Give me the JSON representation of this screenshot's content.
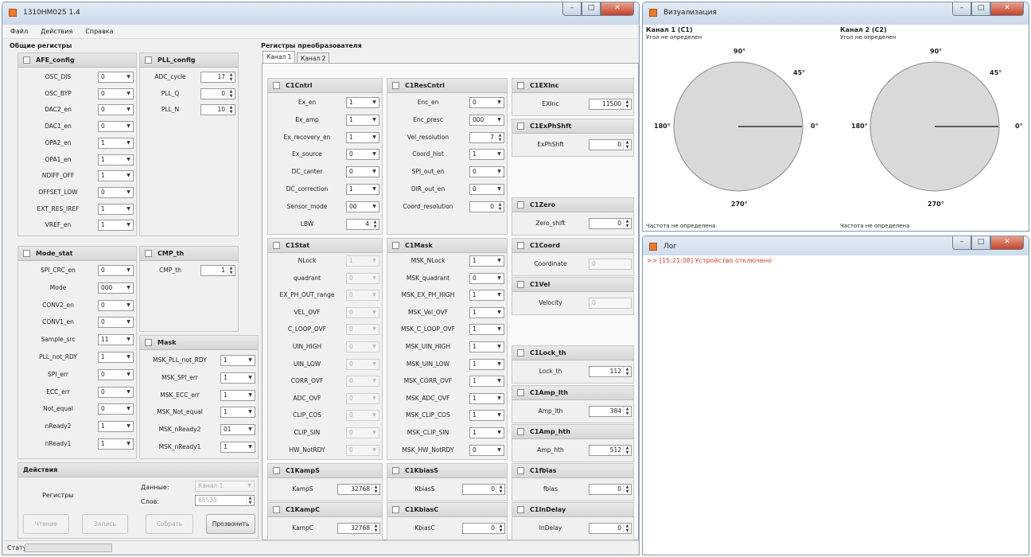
{
  "main_window": {
    "title": "1310HM025 1.4",
    "menu": [
      "Файл",
      "Действия",
      "Справка"
    ]
  },
  "general": {
    "heading": "Общие регистры",
    "afe": {
      "title": "AFE_config",
      "rows": [
        {
          "label": "OSC_DIS",
          "value": "0"
        },
        {
          "label": "OSC_BYP",
          "value": "0"
        },
        {
          "label": "DAC2_en",
          "value": "0"
        },
        {
          "label": "DAC1_en",
          "value": "0"
        },
        {
          "label": "OPA2_en",
          "value": "1"
        },
        {
          "label": "OPA1_en",
          "value": "1"
        },
        {
          "label": "NDIFF_OFF",
          "value": "1"
        },
        {
          "label": "OFFSET_LOW",
          "value": "0"
        },
        {
          "label": "EXT_RES_IREF",
          "value": "1"
        },
        {
          "label": "VREF_en",
          "value": "1"
        }
      ]
    },
    "pll": {
      "title": "PLL_config",
      "rows": [
        {
          "label": "ADC_cycle",
          "value": "17"
        },
        {
          "label": "PLL_Q",
          "value": "0"
        },
        {
          "label": "PLL_N",
          "value": "10"
        }
      ]
    },
    "mode_stat": {
      "title": "Mode_stat",
      "rows": [
        {
          "label": "SPI_CRC_en",
          "value": "0"
        },
        {
          "label": "Mode",
          "value": "000"
        },
        {
          "label": "CONV2_en",
          "value": "0"
        },
        {
          "label": "CONV1_en",
          "value": "0"
        },
        {
          "label": "Sample_src",
          "value": "11"
        },
        {
          "label": "PLL_not_RDY",
          "value": "1"
        },
        {
          "label": "SPI_err",
          "value": "0"
        },
        {
          "label": "ECC_err",
          "value": "0"
        },
        {
          "label": "Not_equal",
          "value": "0"
        },
        {
          "label": "nReady2",
          "value": "1"
        },
        {
          "label": "nReady1",
          "value": "1"
        }
      ]
    },
    "cmp": {
      "title": "CMP_th",
      "rows": [
        {
          "label": "CMP_th",
          "value": "1"
        }
      ]
    },
    "mask": {
      "title": "Mask",
      "rows": [
        {
          "label": "MSK_PLL_not_RDY",
          "value": "1"
        },
        {
          "label": "MSK_SPI_err",
          "value": "1"
        },
        {
          "label": "MSK_ECC_err",
          "value": "1"
        },
        {
          "label": "MSK_Not_equal",
          "value": "1"
        },
        {
          "label": "MSK_nReady2",
          "value": "01"
        },
        {
          "label": "MSK_nReady1",
          "value": "1"
        }
      ]
    }
  },
  "actions": {
    "title": "Действия",
    "registers_label": "Регистры",
    "data_label": "Данные:",
    "data_value": "Канал 1",
    "word_label": "Слов:",
    "word_value": "65535",
    "buttons": [
      "Чтение",
      "Запись",
      "Собрать",
      "Прозвонить"
    ]
  },
  "status": {
    "label": "Статус:",
    "progress": 0
  },
  "conv": {
    "heading": "Регистры преобразователя",
    "tabs": [
      "Канал 1",
      "Канал 2"
    ],
    "c1cntrl": {
      "title": "C1Cntrl",
      "rows": [
        {
          "label": "Ex_en",
          "value": "1",
          "kind": "dd"
        },
        {
          "label": "Ex_amp",
          "value": "1",
          "kind": "dd"
        },
        {
          "label": "Ex_recovery_en",
          "value": "1",
          "kind": "dd"
        },
        {
          "label": "Ex_source",
          "value": "0",
          "kind": "dd"
        },
        {
          "label": "DC_canter",
          "value": "0",
          "kind": "dd"
        },
        {
          "label": "DC_correction",
          "value": "1",
          "kind": "dd"
        },
        {
          "label": "Sensor_mode",
          "value": "00",
          "kind": "dd"
        },
        {
          "label": "LBW",
          "value": "4",
          "kind": "sp"
        }
      ]
    },
    "c1rescntrl": {
      "title": "C1ResCntrl",
      "rows": [
        {
          "label": "Enc_en",
          "value": "0",
          "kind": "dd"
        },
        {
          "label": "Enc_presc",
          "value": "000",
          "kind": "dd"
        },
        {
          "label": "Vel_resolution",
          "value": "7",
          "kind": "sp"
        },
        {
          "label": "Coord_hist",
          "value": "1",
          "kind": "dd"
        },
        {
          "label": "SPI_out_en",
          "value": "0",
          "kind": "dd"
        },
        {
          "label": "DIR_out_en",
          "value": "0",
          "kind": "dd"
        },
        {
          "label": "Coord_resolution",
          "value": "0",
          "kind": "sp"
        }
      ]
    },
    "c1exinc": {
      "title": "C1EXInc",
      "label": "EXInc",
      "value": "11500"
    },
    "c1exphshft": {
      "title": "C1ExPhShft",
      "label": "ExPhShft",
      "value": "0"
    },
    "c1zero": {
      "title": "C1Zero",
      "label": "Zero_shift",
      "value": "0"
    },
    "c1coord": {
      "title": "C1Coord",
      "label": "Coordinate",
      "value": "0"
    },
    "c1vel": {
      "title": "C1Vel",
      "label": "Velocity",
      "value": "0"
    },
    "c1stat": {
      "title": "C1Stat",
      "rows": [
        {
          "label": "NLock",
          "value": "1"
        },
        {
          "label": "quadrant",
          "value": "0"
        },
        {
          "label": "EX_PH_OUT_range",
          "value": "0"
        },
        {
          "label": "VEL_OVF",
          "value": "0"
        },
        {
          "label": "C_LOOP_OVF",
          "value": "0"
        },
        {
          "label": "UIN_HIGH",
          "value": "0"
        },
        {
          "label": "UIN_LOW",
          "value": "0"
        },
        {
          "label": "CORR_OVF",
          "value": "0"
        },
        {
          "label": "ADC_OVF",
          "value": "0"
        },
        {
          "label": "CLIP_COS",
          "value": "0"
        },
        {
          "label": "CLIP_SIN",
          "value": "0"
        },
        {
          "label": "HW_NotRDY",
          "value": "0"
        }
      ]
    },
    "c1mask": {
      "title": "C1Mask",
      "rows": [
        {
          "label": "MSK_NLock",
          "value": "1"
        },
        {
          "label": "MSK_quadrant",
          "value": "0"
        },
        {
          "label": "MSK_EX_PH_HIGH",
          "value": "1"
        },
        {
          "label": "MSK_Vel_OVF",
          "value": "1"
        },
        {
          "label": "MSK_C_LOOP_OVF",
          "value": "1"
        },
        {
          "label": "MSK_UIN_HIGH",
          "value": "1"
        },
        {
          "label": "MSK_UIN_LOW",
          "value": "1"
        },
        {
          "label": "MSK_CORR_OVF",
          "value": "1"
        },
        {
          "label": "MSK_ADC_OVF",
          "value": "1"
        },
        {
          "label": "MSK_CLIP_COS",
          "value": "1"
        },
        {
          "label": "MSK_CLIP_SIN",
          "value": "1"
        },
        {
          "label": "MSK_HW_NotRDY",
          "value": "0"
        }
      ]
    },
    "c1lock": {
      "title": "C1Lock_th",
      "label": "Lock_th",
      "value": "112"
    },
    "c1ampl": {
      "title": "C1Amp_lth",
      "label": "Amp_lth",
      "value": "384"
    },
    "c1amph": {
      "title": "C1Amp_hth",
      "label": "Amp_hth",
      "value": "512"
    },
    "c1kamps": {
      "title": "C1KampS",
      "label": "KampS",
      "value": "32768"
    },
    "c1kampc": {
      "title": "C1KampC",
      "label": "KampC",
      "value": "32768"
    },
    "c1kbiass": {
      "title": "C1KbiasS",
      "label": "KbiasS",
      "value": "0"
    },
    "c1kbiasc": {
      "title": "C1KbiasC",
      "label": "KbiasC",
      "value": "0"
    },
    "c1fbias": {
      "title": "C1fbias",
      "label": "fbias",
      "value": "0"
    },
    "c1indelay": {
      "title": "C1InDelay",
      "label": "InDelay",
      "value": "0"
    }
  },
  "viz": {
    "title": "Визуализация",
    "ch1_title": "Канал 1 (C1)",
    "ch2_title": "Канал 2 (C2)",
    "angle_text": "Угол не определен",
    "freq_text": "Частота не определена",
    "dial_labels": {
      "deg90": "90°",
      "deg45": "45°",
      "deg0": "0°",
      "deg180": "180°",
      "deg270": "270°"
    },
    "ch1_angle_deg": 0,
    "ch2_angle_deg": 0
  },
  "log": {
    "title": "Лог",
    "lines": [
      ">> [15:21:08] Устройство отключено"
    ],
    "line_color": "#d0442b"
  },
  "colors": {
    "titlebar": "#c9d9ea",
    "close": "#c4442b",
    "dial": "#d9d9d9"
  }
}
